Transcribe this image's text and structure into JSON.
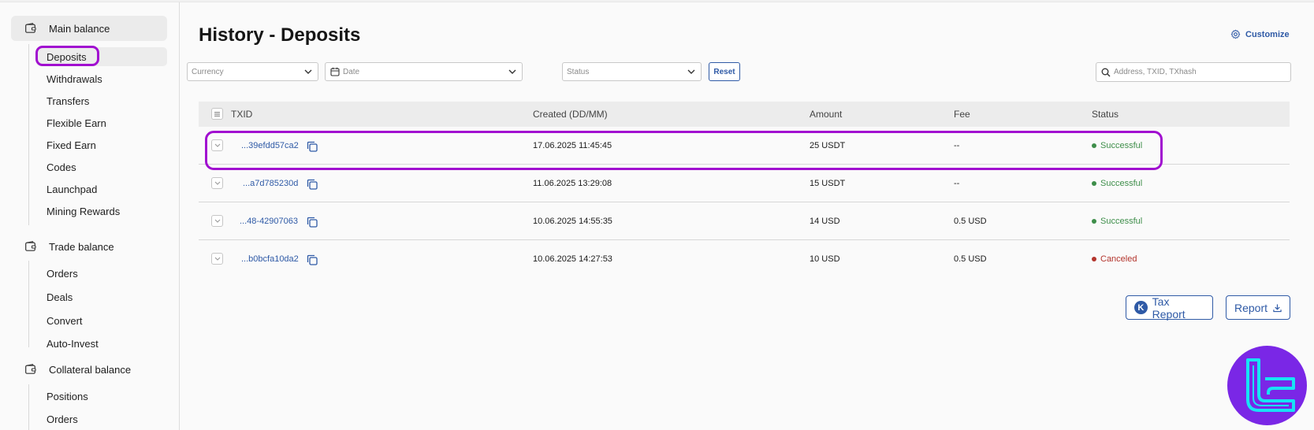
{
  "sidebar": {
    "groups": [
      {
        "label": "Main balance",
        "items": [
          "Deposits",
          "Withdrawals",
          "Transfers",
          "Flexible Earn",
          "Fixed Earn",
          "Codes",
          "Launchpad",
          "Mining Rewards"
        ]
      },
      {
        "label": "Trade balance",
        "items": [
          "Orders",
          "Deals",
          "Convert",
          "Auto-Invest"
        ]
      },
      {
        "label": "Collateral balance",
        "items": [
          "Positions",
          "Orders"
        ]
      }
    ],
    "current_item": "Deposits"
  },
  "header": {
    "title": "History - Deposits",
    "customize_label": "Customize"
  },
  "filters": {
    "currency_placeholder": "Currency",
    "date_placeholder": "Date",
    "status_placeholder": "Status",
    "reset_label": "Reset",
    "search_placeholder": "Address, TXID, TXhash"
  },
  "table": {
    "columns": [
      "TXID",
      "Created (DD/MM)",
      "Amount",
      "Fee",
      "Status"
    ],
    "rows": [
      {
        "txid": "...39efdd57ca2",
        "created": "17.06.2025 11:45:45",
        "amount": "25 USDT",
        "fee": "--",
        "status": "Successful"
      },
      {
        "txid": "...a7d785230d",
        "created": "11.06.2025 13:29:08",
        "amount": "15 USDT",
        "fee": "--",
        "status": "Successful"
      },
      {
        "txid": "...48-42907063",
        "created": "10.06.2025 14:55:35",
        "amount": "14 USD",
        "fee": "0.5 USD",
        "status": "Successful"
      },
      {
        "txid": "...b0bcfa10da2",
        "created": "10.06.2025 14:27:53",
        "amount": "10 USD",
        "fee": "0.5 USD",
        "status": "Canceled"
      }
    ]
  },
  "actions": {
    "tax_report_badge": "K",
    "tax_report_label": "Tax Report",
    "report_label": "Report"
  },
  "colors": {
    "accent": "#2f5aa6",
    "success": "#3e8e4a",
    "canceled": "#b3342c",
    "highlight": "#a10fd0",
    "logo_bg": "#7a27e6",
    "logo_fg": "#17e3f5"
  },
  "icons": {
    "wallet": "wallet-icon",
    "gear": "gear-icon",
    "calendar": "calendar-icon",
    "search": "search-icon",
    "copy": "copy-icon",
    "download": "download-icon"
  }
}
